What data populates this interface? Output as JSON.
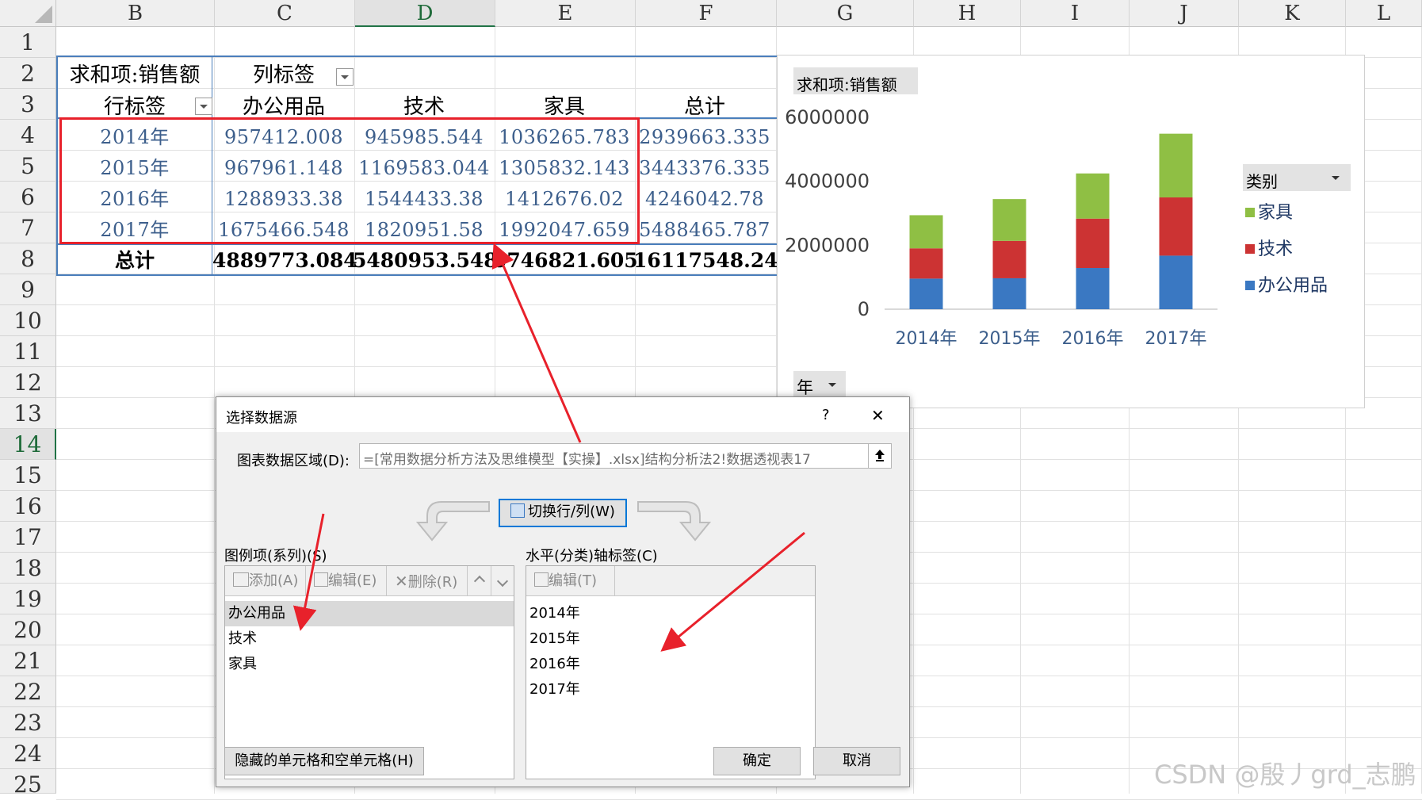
{
  "spreadsheet": {
    "columns": [
      "B",
      "C",
      "D",
      "E",
      "F",
      "G",
      "H",
      "I",
      "J",
      "K",
      "L"
    ],
    "rows": [
      "1",
      "2",
      "3",
      "4",
      "5",
      "6",
      "7",
      "8",
      "9",
      "10",
      "11",
      "12",
      "13",
      "14",
      "15",
      "16",
      "17",
      "18",
      "19",
      "20",
      "21",
      "22",
      "23",
      "24",
      "25"
    ]
  },
  "pivot": {
    "value_field": "求和项:销售额",
    "column_labels": "列标签",
    "row_labels": "行标签",
    "headers": [
      "办公用品",
      "技术",
      "家具",
      "总计"
    ],
    "rows": [
      {
        "label": "2014年",
        "values": [
          "957412.008",
          "945985.544",
          "1036265.783",
          "2939663.335"
        ]
      },
      {
        "label": "2015年",
        "values": [
          "967961.148",
          "1169583.044",
          "1305832.143",
          "3443376.335"
        ]
      },
      {
        "label": "2016年",
        "values": [
          "1288933.38",
          "1544433.38",
          "1412676.02",
          "4246042.78"
        ]
      },
      {
        "label": "2017年",
        "values": [
          "1675466.548",
          "1820951.58",
          "1992047.659",
          "5488465.787"
        ]
      }
    ],
    "total_label": "总计",
    "totals": [
      "4889773.084",
      "5480953.548",
      "5746821.605",
      "16117548.24"
    ]
  },
  "chart": {
    "field_button": "求和项:销售额",
    "legend_field": "类别",
    "axis_field": "年",
    "y_ticks": [
      "6000000",
      "4000000",
      "2000000",
      "0"
    ],
    "legend": [
      {
        "name": "家具",
        "color": "#8fbf44"
      },
      {
        "name": "技术",
        "color": "#cc3333"
      },
      {
        "name": "办公用品",
        "color": "#3a78c2"
      }
    ]
  },
  "chart_data": {
    "type": "bar",
    "stacked": true,
    "categories": [
      "2014年",
      "2015年",
      "2016年",
      "2017年"
    ],
    "series": [
      {
        "name": "办公用品",
        "values": [
          957412.008,
          967961.148,
          1288933.38,
          1675466.548
        ],
        "color": "#3a78c2"
      },
      {
        "name": "技术",
        "values": [
          945985.544,
          1169583.044,
          1544433.38,
          1820951.58
        ],
        "color": "#cc3333"
      },
      {
        "name": "家具",
        "values": [
          1036265.783,
          1305832.143,
          1412676.02,
          1992047.659
        ],
        "color": "#8fbf44"
      }
    ],
    "ylim": [
      0,
      6000000
    ],
    "legend_position": "right",
    "grid": false
  },
  "dialog": {
    "title": "选择数据源",
    "help": "?",
    "close": "✕",
    "range_label": "图表数据区域(D):",
    "range_value": "=[常用数据分析方法及思维模型【实操】.xlsx]结构分析法2!数据透视表17",
    "switch_button": "切换行/列(W)",
    "series_label": "图例项(系列)(S)",
    "series_toolbar": {
      "add": "添加(A)",
      "edit": "编辑(E)",
      "delete": "删除(R)"
    },
    "series_items": [
      "办公用品",
      "技术",
      "家具"
    ],
    "axis_label": "水平(分类)轴标签(C)",
    "axis_toolbar": {
      "edit": "编辑(T)"
    },
    "axis_items": [
      "2014年",
      "2015年",
      "2016年",
      "2017年"
    ],
    "hidden_cells_button": "隐藏的单元格和空单元格(H)",
    "ok_button": "确定",
    "cancel_button": "取消"
  },
  "watermark": "CSDN @殷丿grd_志鹏",
  "colors": {
    "annotation_red": "#e8212b",
    "pivot_blue": "#4a7ebb"
  }
}
